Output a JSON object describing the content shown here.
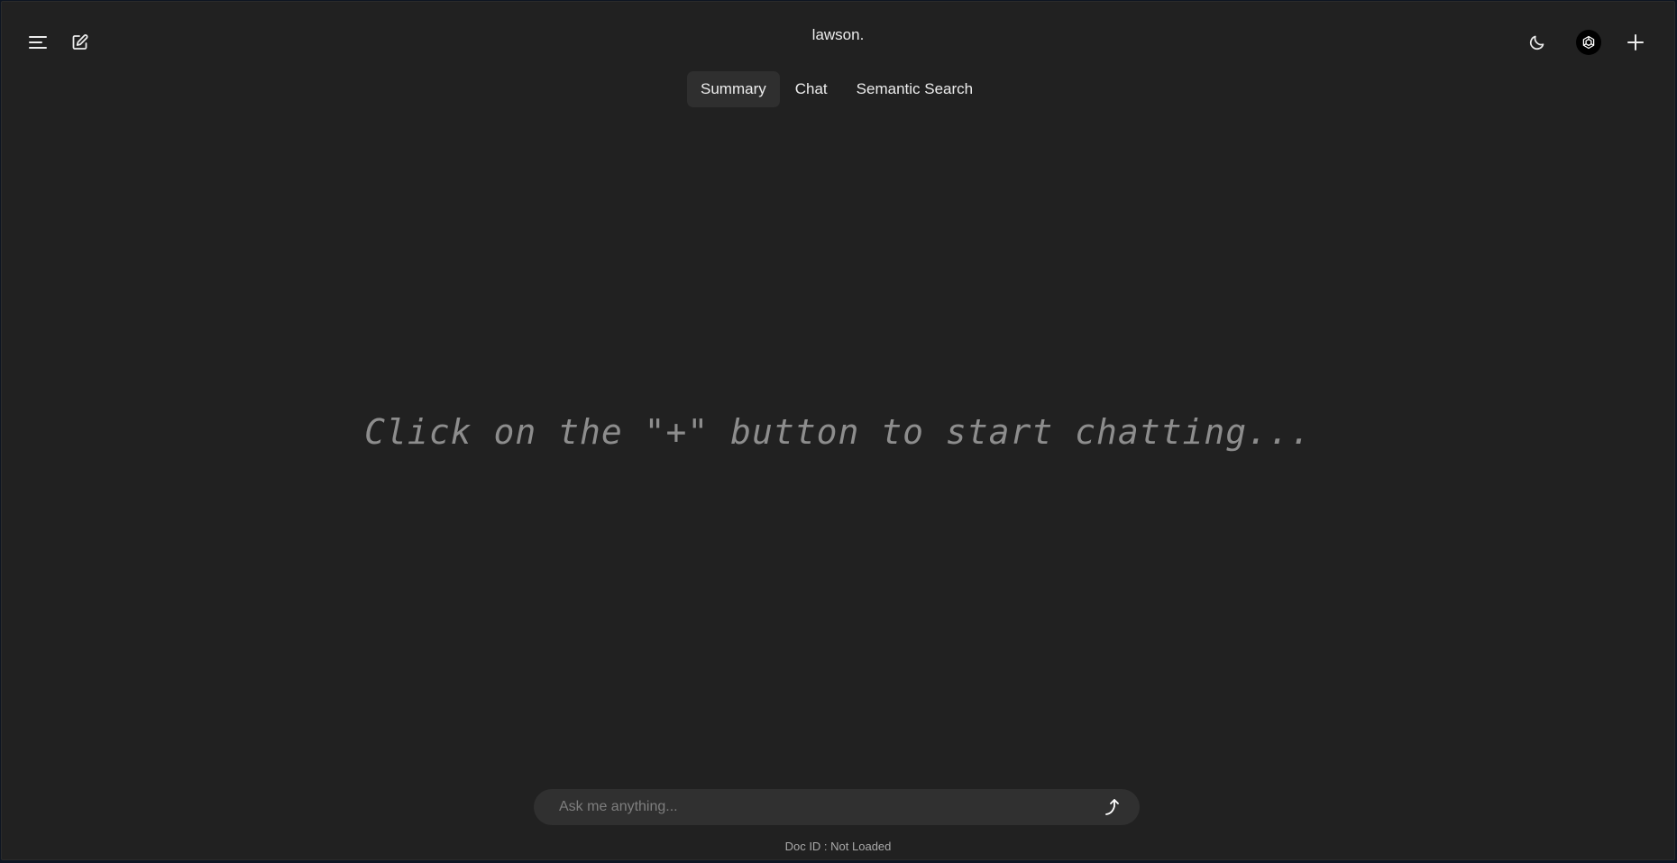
{
  "header": {
    "title": "lawson.",
    "menu_icon": "menu-icon",
    "edit_icon": "edit-icon",
    "theme_icon": "moon-icon",
    "avatar_icon": "openai-logo-icon",
    "new_icon": "plus-icon"
  },
  "tabs": [
    {
      "label": "Summary",
      "active": true
    },
    {
      "label": "Chat",
      "active": false
    },
    {
      "label": "Semantic Search",
      "active": false
    }
  ],
  "main": {
    "empty_message": "Click on the \"+\" button to start chatting..."
  },
  "composer": {
    "placeholder": "Ask me anything...",
    "value": "",
    "send_icon": "send-arrow-icon"
  },
  "footer": {
    "doc_id": "Doc ID : Not Loaded"
  },
  "colors": {
    "background": "#212121",
    "tab_active": "#2f2f2f",
    "input_bg": "#303030",
    "text": "#ececec",
    "muted": "#8d8d8d"
  }
}
